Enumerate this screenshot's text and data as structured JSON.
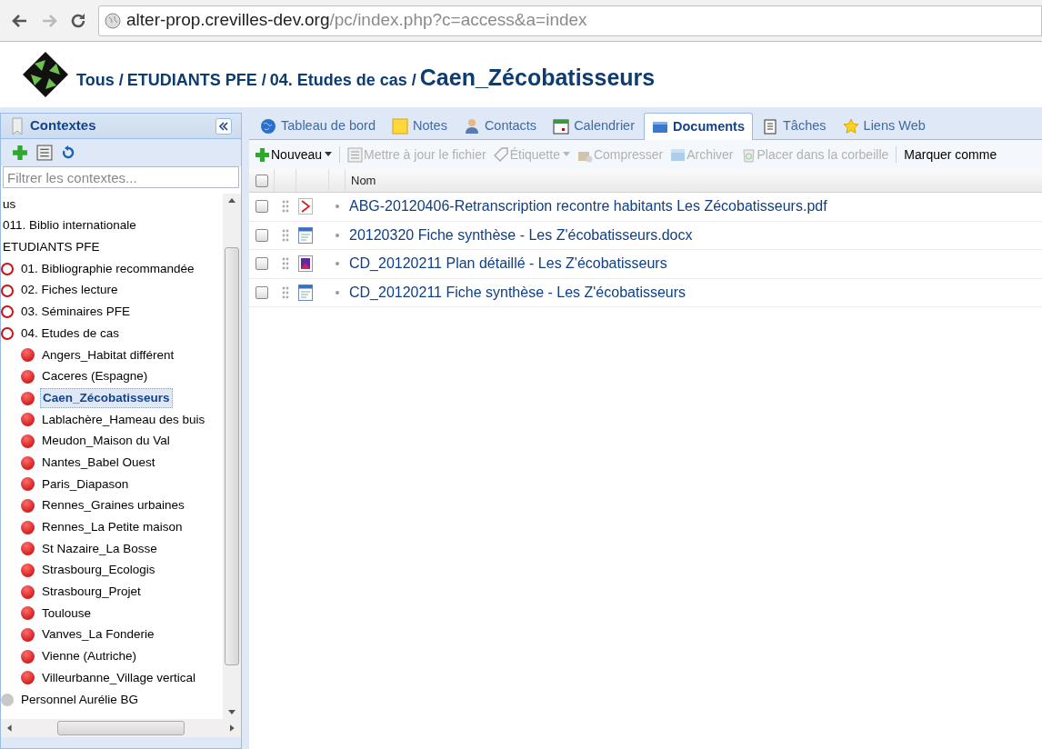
{
  "browser": {
    "url_host": "alter-prop.crevilles-dev.org",
    "url_path": "/pc/index.php?c=access&a=index"
  },
  "breadcrumb": {
    "path": [
      "Tous /",
      "ETUDIANTS PFE /",
      "04. Etudes de cas /"
    ],
    "current": "Caen_Zécobatisseurs"
  },
  "sidebar": {
    "title": "Contextes",
    "filter_placeholder": "Filtrer les contextes...",
    "tree": [
      {
        "label": "us",
        "kind": "none",
        "selected": false
      },
      {
        "label": "011. Biblio internationale",
        "kind": "none",
        "selected": false
      },
      {
        "label": "ETUDIANTS PFE",
        "kind": "none",
        "selected": false,
        "children": [
          {
            "label": "01. Bibliographie recommandée",
            "kind": "ring",
            "selected": false
          },
          {
            "label": "02. Fiches lecture",
            "kind": "ring",
            "selected": false
          },
          {
            "label": "03. Séminaires PFE",
            "kind": "ring",
            "selected": false
          },
          {
            "label": "04. Etudes de cas",
            "kind": "ring",
            "selected": false,
            "children": [
              {
                "label": "Angers_Habitat différent",
                "kind": "dot",
                "selected": false
              },
              {
                "label": "Caceres (Espagne)",
                "kind": "dot",
                "selected": false
              },
              {
                "label": "Caen_Zécobatisseurs",
                "kind": "dot",
                "selected": true
              },
              {
                "label": "Lablachère_Hameau des buis",
                "kind": "dot",
                "selected": false
              },
              {
                "label": "Meudon_Maison du Val",
                "kind": "dot",
                "selected": false
              },
              {
                "label": "Nantes_Babel Ouest",
                "kind": "dot",
                "selected": false
              },
              {
                "label": "Paris_Diapason",
                "kind": "dot",
                "selected": false
              },
              {
                "label": "Rennes_Graines urbaines",
                "kind": "dot",
                "selected": false
              },
              {
                "label": "Rennes_La Petite maison",
                "kind": "dot",
                "selected": false
              },
              {
                "label": "St Nazaire_La Bosse",
                "kind": "dot",
                "selected": false
              },
              {
                "label": "Strasbourg_Ecologis",
                "kind": "dot",
                "selected": false
              },
              {
                "label": "Strasbourg_Projet",
                "kind": "dot",
                "selected": false
              },
              {
                "label": "Toulouse",
                "kind": "dot",
                "selected": false
              },
              {
                "label": "Vanves_La Fonderie",
                "kind": "dot",
                "selected": false
              },
              {
                "label": "Vienne (Autriche)",
                "kind": "dot",
                "selected": false
              },
              {
                "label": "Villeurbanne_Village vertical",
                "kind": "dot",
                "selected": false
              }
            ]
          }
        ]
      },
      {
        "label": "Personnel Aurélie BG",
        "kind": "grey",
        "selected": false
      }
    ]
  },
  "tabs": [
    {
      "label": "Tableau de bord",
      "kind": "globe",
      "selected": false
    },
    {
      "label": "Notes",
      "kind": "note",
      "selected": false
    },
    {
      "label": "Contacts",
      "kind": "person",
      "selected": false
    },
    {
      "label": "Calendrier",
      "kind": "calendar",
      "selected": false
    },
    {
      "label": "Documents",
      "kind": "folder",
      "selected": true
    },
    {
      "label": "Tâches",
      "kind": "tasks",
      "selected": false
    },
    {
      "label": "Liens Web",
      "kind": "star",
      "selected": false
    }
  ],
  "toolbar": [
    {
      "label": "Nouveau",
      "kind": "plus",
      "disabled": false,
      "dropdown": true
    },
    {
      "label": "Mettre à jour le fichier",
      "kind": "list",
      "disabled": true,
      "dropdown": false
    },
    {
      "label": "Étiquette",
      "kind": "tag",
      "disabled": true,
      "dropdown": true
    },
    {
      "label": "Compresser",
      "kind": "box",
      "disabled": true,
      "dropdown": false
    },
    {
      "label": "Archiver",
      "kind": "archive",
      "disabled": true,
      "dropdown": false
    },
    {
      "label": "Placer dans la corbeille",
      "kind": "bin",
      "disabled": true,
      "dropdown": false
    },
    {
      "label": "Marquer comme",
      "kind": "text",
      "disabled": false,
      "dropdown": false
    }
  ],
  "table": {
    "column": "Nom",
    "all_checked": false,
    "rows": [
      {
        "name": "ABG-20120406-Retranscription recontre habitants Les Zécobatisseurs.pdf",
        "kind": "pdf",
        "checked": false
      },
      {
        "name": "20120320 Fiche synthèse - Les Z'écobatisseurs.docx",
        "kind": "doc",
        "checked": false
      },
      {
        "name": "CD_20120211 Plan détaillé - Les Z'écobatisseurs",
        "kind": "image",
        "checked": false
      },
      {
        "name": "CD_20120211 Fiche synthèse - Les Z'écobatisseurs",
        "kind": "doc",
        "checked": false
      }
    ]
  }
}
